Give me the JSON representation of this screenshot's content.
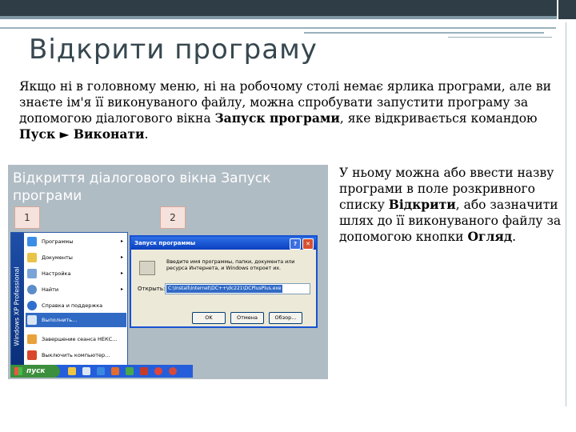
{
  "slide": {
    "title": "Відкрити програму",
    "intro_part1": "Якщо ні в головному меню, ні на робочому столі немає ярлика програми, але ви знаєте ім'я її виконуваного файлу, можна спробувати запустити програму за допомогою діалогового вікна ",
    "intro_bold1": "Запуск програми",
    "intro_part2": ", яке відкривається командою ",
    "intro_bold2": "Пуск ► Виконати",
    "intro_part3": ".",
    "right_part1": "У ньому можна або ввести назву програми в поле розкривного списку ",
    "right_bold1": "Відкрити",
    "right_part2": ", або зазначити шлях до її виконуваного файлу за допомогою кнопки ",
    "right_bold2": "Огляд",
    "right_part3": "."
  },
  "screenshot": {
    "caption": "Відкриття діалогового вікна Запуск програми",
    "step1": "1",
    "step2": "2",
    "start_menu": {
      "side_label": "Windows XP Professional",
      "items": [
        {
          "label": "Программы",
          "arrow": "▸"
        },
        {
          "label": "Документы",
          "arrow": "▸"
        },
        {
          "label": "Настройка",
          "arrow": "▸"
        },
        {
          "label": "Найти",
          "arrow": "▸"
        },
        {
          "label": "Справка и поддержка",
          "arrow": ""
        },
        {
          "label": "Выполнить...",
          "arrow": ""
        },
        {
          "label": "Завершение сеанса НЕКС...",
          "arrow": ""
        },
        {
          "label": "Выключить компьютер...",
          "arrow": ""
        }
      ]
    },
    "taskbar": {
      "start_label": "пуск"
    },
    "dialog": {
      "title": "Запуск программы",
      "help_btn": "?",
      "close_btn": "✕",
      "description": "Введите имя программы, папки, документа или ресурса Интернета, и Windows откроет их.",
      "open_label": "Открыть:",
      "open_value": "C:\\Install\\Internet\\DC++\\dc221\\DCPlusPlus.exe",
      "ok": "OK",
      "cancel": "Отмена",
      "browse": "Обзор..."
    }
  },
  "colors": {
    "title": "#37474f",
    "accent_bar": "#2f3e46",
    "image_bg": "#b0bcc4",
    "selection": "#316ac5"
  }
}
